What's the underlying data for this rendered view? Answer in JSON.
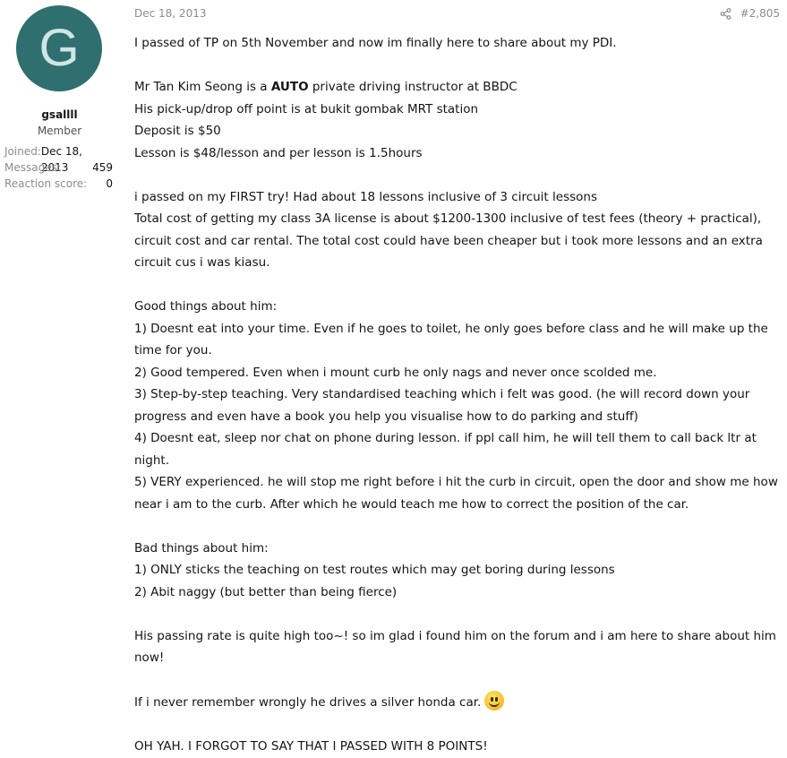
{
  "user": {
    "avatar_letter": "G",
    "avatar_color": "#2f6f6f",
    "username": "gsallll",
    "title": "Member",
    "stats": [
      {
        "label": "Joined:",
        "value": "Dec 18, 2013"
      },
      {
        "label": "Messages:",
        "value": "459"
      },
      {
        "label": "Reaction score:",
        "value": "0"
      }
    ]
  },
  "post": {
    "date": "Dec 18, 2013",
    "share_icon": "share-icon",
    "number": "#2,805",
    "lines": {
      "l1": "I passed of TP on 5th November and now im finally here to share about my PDI.",
      "l2_pre": "Mr Tan Kim Seong is a ",
      "l2_bold": "AUTO",
      "l2_post": " private driving instructor at BBDC",
      "l3": "His pick-up/drop off point is at bukit gombak MRT station",
      "l4": "Deposit is $50",
      "l5": "Lesson is $48/lesson and per lesson is 1.5hours",
      "l6": "i passed on my FIRST try! Had about 18 lessons inclusive of 3 circuit lessons",
      "l7": "Total cost of getting my class 3A license is about $1200-1300 inclusive of test fees (theory + practical), circuit cost and car rental. The total cost could have been cheaper but i took more lessons and an extra circuit cus i was kiasu.",
      "l8": "Good things about him:",
      "l9": "1) Doesnt eat into your time. Even if he goes to toilet, he only goes before class and he will make up the time for you.",
      "l10": "2) Good tempered. Even when i mount curb he only nags and never once scolded me.",
      "l11": "3) Step-by-step teaching. Very standardised teaching which i felt was good. (he will record down your progress and even have a book you help you visualise how to do parking and stuff)",
      "l12": "4) Doesnt eat, sleep nor chat on phone during lesson. if ppl call him, he will tell them to call back ltr at night.",
      "l13": "5) VERY experienced. he will stop me right before i hit the curb in circuit, open the door and show me how near i am to the curb. After which he would teach me how to correct the position of the car.",
      "l14": "Bad things about him:",
      "l15": "1) ONLY sticks the teaching on test routes which may get boring during lessons",
      "l16": "2) Abit naggy (but better than being fierce)",
      "l17": "His passing rate is quite high too~! so im glad i found him on the forum and i am here to share about him now!",
      "l18": "If i never remember wrongly he drives a silver honda car.",
      "smilie_icon": "smile-emoji-icon",
      "l19": "OH YAH. I FORGOT TO SAY THAT I PASSED WITH 8 POINTS!"
    }
  }
}
